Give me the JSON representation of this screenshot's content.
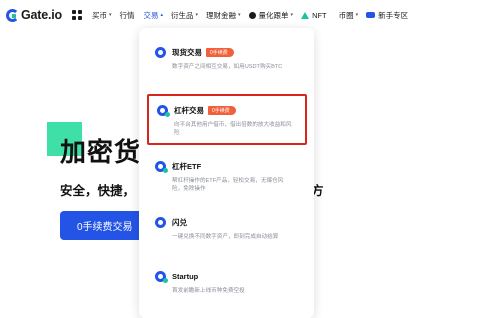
{
  "nav": {
    "logo_text": "Gate.io",
    "items": [
      {
        "label": "买币",
        "caret": "▾"
      },
      {
        "label": "行情",
        "caret": ""
      },
      {
        "label": "交易",
        "caret": "▴"
      },
      {
        "label": "衍生品",
        "caret": "▾"
      },
      {
        "label": "理财金融",
        "caret": "▾"
      },
      {
        "label": "量化跟单",
        "caret": "▾"
      },
      {
        "label": "NFT",
        "caret": ""
      },
      {
        "label": "币圈",
        "caret": "▾"
      },
      {
        "label": "新手专区",
        "caret": ""
      }
    ]
  },
  "hero": {
    "title": "加密货",
    "subtitle": "安全，快捷，",
    "subtitle_tail": "方",
    "button_label": "0手续费交易"
  },
  "dropdown": {
    "items": [
      {
        "title": "现货交易",
        "badge": "0手续费",
        "desc": "数字资产之间相互交易，如用USDT购买BTC"
      },
      {
        "title": "杠杆交易",
        "badge": "0手续费",
        "desc": "向平台其他用户借币，借出倍数的放大收益和风险"
      },
      {
        "title": "杠杆ETF",
        "badge": "",
        "desc": "帮杠杆操作的ETF产品，轻松交易，无爆仓风险，免除操作"
      },
      {
        "title": "闪兑",
        "badge": "",
        "desc": "一键兑换不同数字资产，即刻完成自动结算"
      },
      {
        "title": "Startup",
        "badge": "",
        "desc": "首发前瞻新上线币种免费空投"
      }
    ]
  },
  "colors": {
    "accent": "#2354e6",
    "highlight_border": "#d9261c",
    "badge": "#f0603a",
    "hero_square": "#3ee0a8"
  }
}
